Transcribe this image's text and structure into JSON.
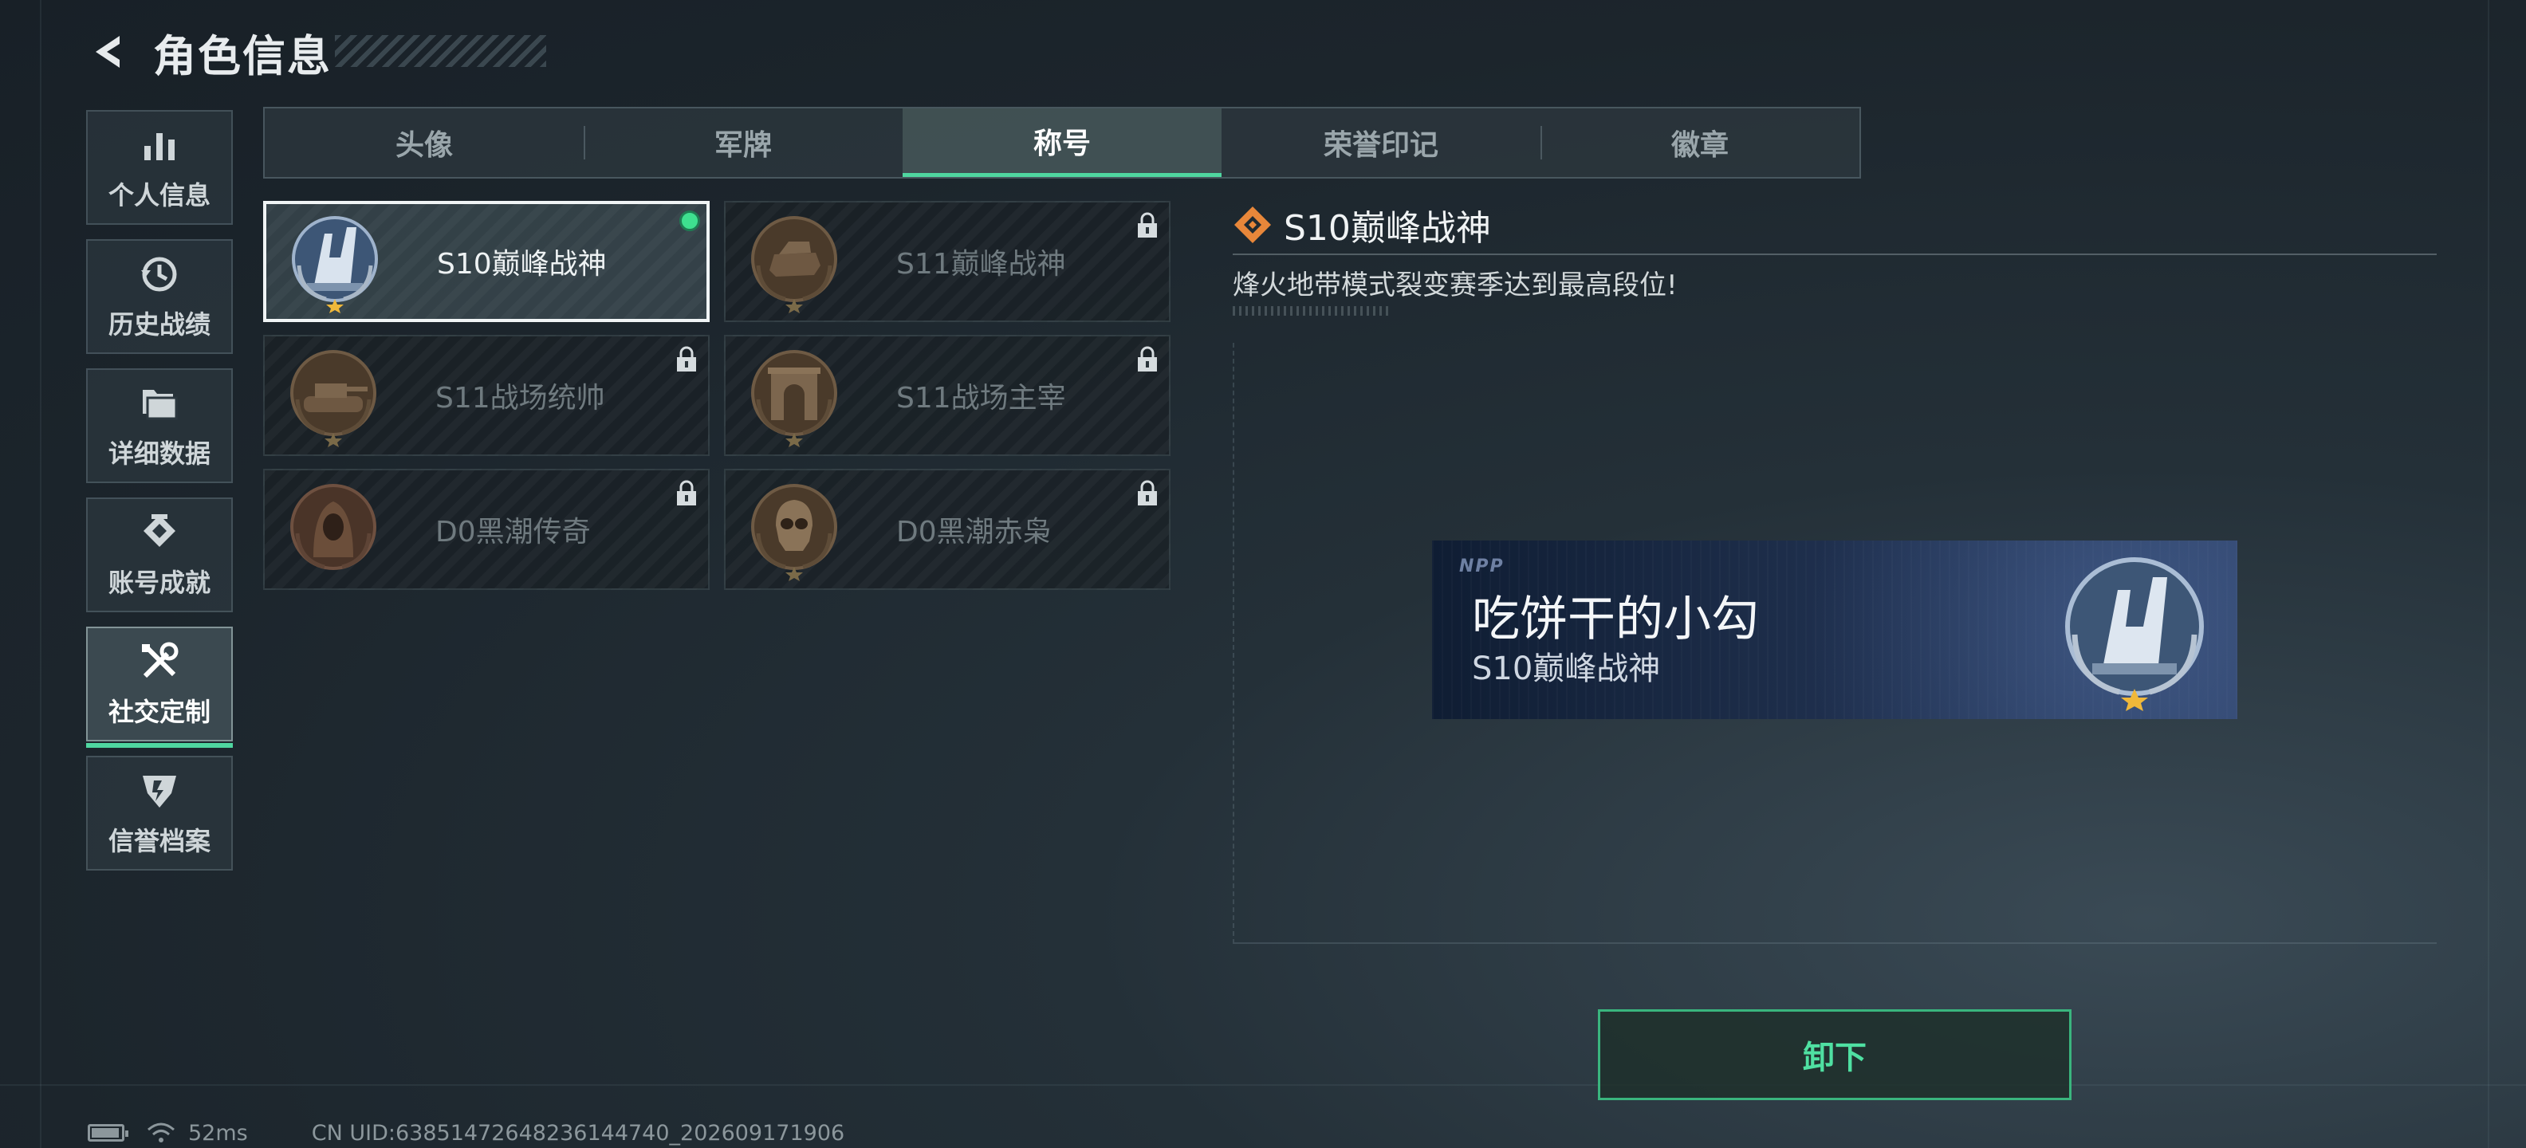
{
  "header": {
    "title": "角色信息"
  },
  "sidebar": {
    "items": [
      {
        "label": "个人信息",
        "icon": "bar-chart-icon",
        "active": false
      },
      {
        "label": "历史战绩",
        "icon": "history-icon",
        "active": false
      },
      {
        "label": "详细数据",
        "icon": "folder-icon",
        "active": false
      },
      {
        "label": "账号成就",
        "icon": "achievement-icon",
        "active": false
      },
      {
        "label": "社交定制",
        "icon": "tools-icon",
        "active": true
      },
      {
        "label": "信誉档案",
        "icon": "credit-badge-icon",
        "active": false
      }
    ]
  },
  "tabs": [
    {
      "label": "头像",
      "active": false
    },
    {
      "label": "军牌",
      "active": false
    },
    {
      "label": "称号",
      "active": true
    },
    {
      "label": "荣誉印记",
      "active": false
    },
    {
      "label": "徽章",
      "active": false
    }
  ],
  "titles": [
    {
      "label": "S10巅峰战神",
      "emblem": "peak-war-god-emblem-icon",
      "selected": true,
      "equipped": true,
      "locked": false
    },
    {
      "label": "S11巅峰战神",
      "emblem": "peak-war-god-emblem-icon",
      "selected": false,
      "equipped": false,
      "locked": true
    },
    {
      "label": "S11战场统帅",
      "emblem": "tank-emblem-icon",
      "selected": false,
      "equipped": false,
      "locked": true
    },
    {
      "label": "S11战场主宰",
      "emblem": "arch-emblem-icon",
      "selected": false,
      "equipped": false,
      "locked": true
    },
    {
      "label": "D0黑潮传奇",
      "emblem": "hooded-figure-emblem-icon",
      "selected": false,
      "equipped": false,
      "locked": true
    },
    {
      "label": "D0黑潮赤枭",
      "emblem": "skull-emblem-icon",
      "selected": false,
      "equipped": false,
      "locked": true
    }
  ],
  "detail": {
    "title": "S10巅峰战神",
    "description": "烽火地带模式裂变赛季达到最高段位!"
  },
  "nameplate": {
    "logo": "NPP",
    "player_name": "吃饼干的小勾",
    "title": "S10巅峰战神"
  },
  "actions": {
    "unequip_label": "卸下"
  },
  "footer": {
    "ping": "52ms",
    "uid": "CN UID:638514726482361447​40_202609171906"
  },
  "colors": {
    "accent_green": "#4fd6a0",
    "equipped_dot": "#3ee08f",
    "detail_diamond": "#e8873a",
    "nameplate_bg": "#1c2c48"
  }
}
